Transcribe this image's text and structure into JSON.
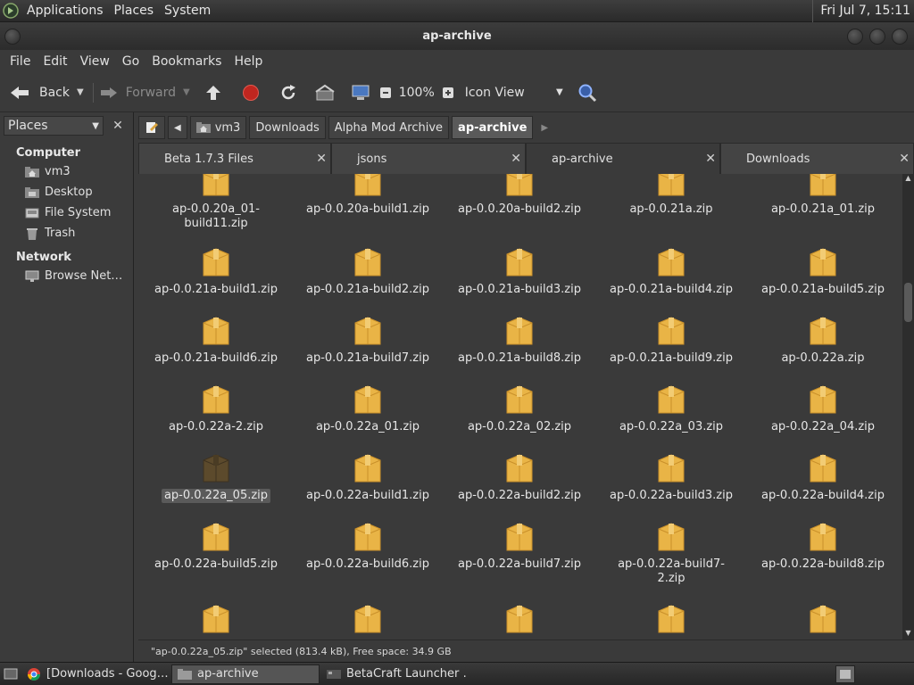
{
  "topbar": {
    "menus": [
      "Applications",
      "Places",
      "System"
    ],
    "clock": "Fri Jul 7, 15:11"
  },
  "window": {
    "title": "ap-archive"
  },
  "menubar": [
    "File",
    "Edit",
    "View",
    "Go",
    "Bookmarks",
    "Help"
  ],
  "toolbar": {
    "back": "Back",
    "forward": "Forward",
    "zoom": "100%",
    "view_mode": "Icon View"
  },
  "sidebar": {
    "selector": "Places",
    "sections": [
      {
        "title": "Computer",
        "items": [
          {
            "label": "vm3",
            "icon": "home-folder-icon"
          },
          {
            "label": "Desktop",
            "icon": "desktop-folder-icon"
          },
          {
            "label": "File System",
            "icon": "drive-icon"
          },
          {
            "label": "Trash",
            "icon": "trash-icon"
          }
        ]
      },
      {
        "title": "Network",
        "items": [
          {
            "label": "Browse Net…",
            "icon": "network-icon"
          }
        ]
      }
    ]
  },
  "pathbar": [
    "vm3",
    "Downloads",
    "Alpha Mod Archive",
    "ap-archive"
  ],
  "tabs": [
    {
      "label": "Beta 1.7.3 Files",
      "active": false
    },
    {
      "label": "jsons",
      "active": false
    },
    {
      "label": "ap-archive",
      "active": true
    },
    {
      "label": "Downloads",
      "active": false
    }
  ],
  "files": [
    [
      "ap-0.0.20a_01-build11.zip",
      "ap-0.0.20a-build1.zip",
      "ap-0.0.20a-build2.zip",
      "ap-0.0.21a.zip",
      "ap-0.0.21a_01.zip"
    ],
    [
      "ap-0.0.21a-build1.zip",
      "ap-0.0.21a-build2.zip",
      "ap-0.0.21a-build3.zip",
      "ap-0.0.21a-build4.zip",
      "ap-0.0.21a-build5.zip"
    ],
    [
      "ap-0.0.21a-build6.zip",
      "ap-0.0.21a-build7.zip",
      "ap-0.0.21a-build8.zip",
      "ap-0.0.21a-build9.zip",
      "ap-0.0.22a.zip"
    ],
    [
      "ap-0.0.22a-2.zip",
      "ap-0.0.22a_01.zip",
      "ap-0.0.22a_02.zip",
      "ap-0.0.22a_03.zip",
      "ap-0.0.22a_04.zip"
    ],
    [
      "ap-0.0.22a_05.zip",
      "ap-0.0.22a-build1.zip",
      "ap-0.0.22a-build2.zip",
      "ap-0.0.22a-build3.zip",
      "ap-0.0.22a-build4.zip"
    ],
    [
      "ap-0.0.22a-build5.zip",
      "ap-0.0.22a-build6.zip",
      "ap-0.0.22a-build7.zip",
      "ap-0.0.22a-build7-2.zip",
      "ap-0.0.22a-build8.zip"
    ],
    [
      "",
      "",
      "",
      "",
      ""
    ]
  ],
  "selected_file": "ap-0.0.22a_05.zip",
  "status": "\"ap-0.0.22a_05.zip\" selected (813.4 kB), Free space: 34.9 GB",
  "taskbar": [
    {
      "label": "[Downloads - Goog…",
      "icon": "chrome-icon",
      "active": false
    },
    {
      "label": "ap-archive",
      "icon": "folder-icon",
      "active": true
    },
    {
      "label": "BetaCraft Launcher …",
      "icon": "betacraft-icon",
      "active": false
    }
  ],
  "colors": {
    "folder_zip": "#e9b446",
    "folder_zip_dark": "#c9902a",
    "selected_zip": "#5c4a2c",
    "stop": "#c0261f"
  }
}
